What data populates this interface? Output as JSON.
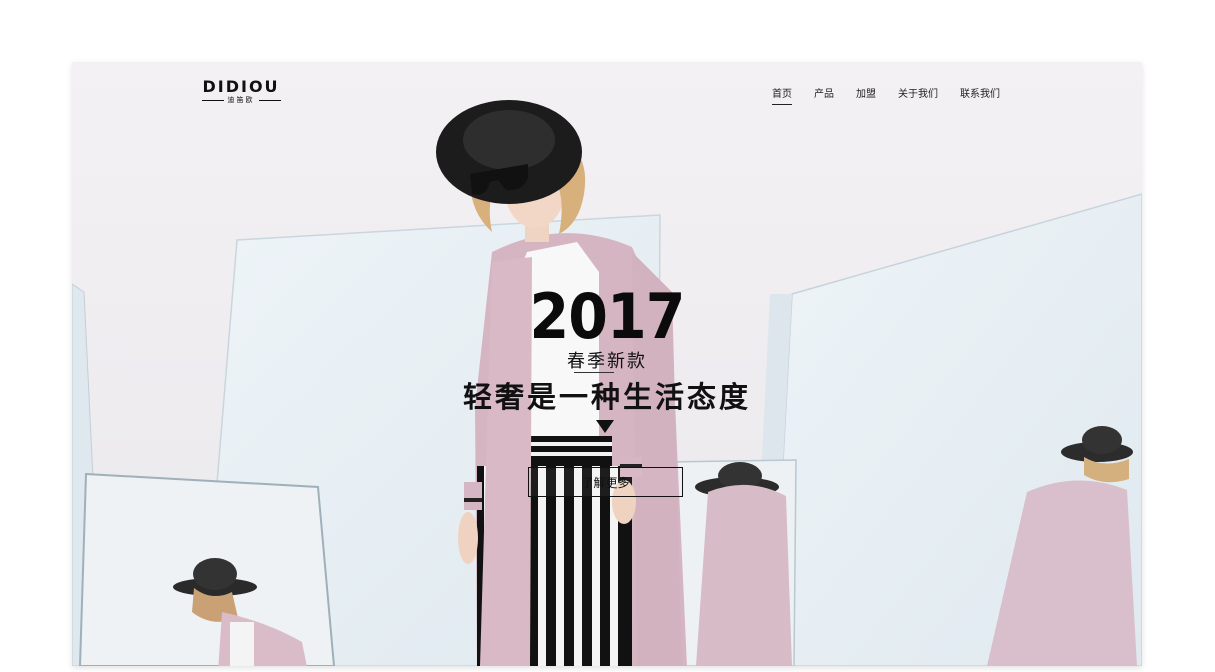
{
  "header": {
    "logo_text": "DIDIOU",
    "logo_sub": "迪笛欧"
  },
  "nav": {
    "items": [
      {
        "label": "首页",
        "active": true
      },
      {
        "label": "产品",
        "active": false
      },
      {
        "label": "加盟",
        "active": false
      },
      {
        "label": "关于我们",
        "active": false
      },
      {
        "label": "联系我们",
        "active": false
      }
    ]
  },
  "hero": {
    "year": "2017",
    "season": "春季新款",
    "slogan": "轻奢是一种生活态度",
    "cta_label": "了解更多"
  },
  "colors": {
    "text": "#111111",
    "cardigan_pink": "#d7b8c4",
    "background": "#f3f1f3"
  }
}
